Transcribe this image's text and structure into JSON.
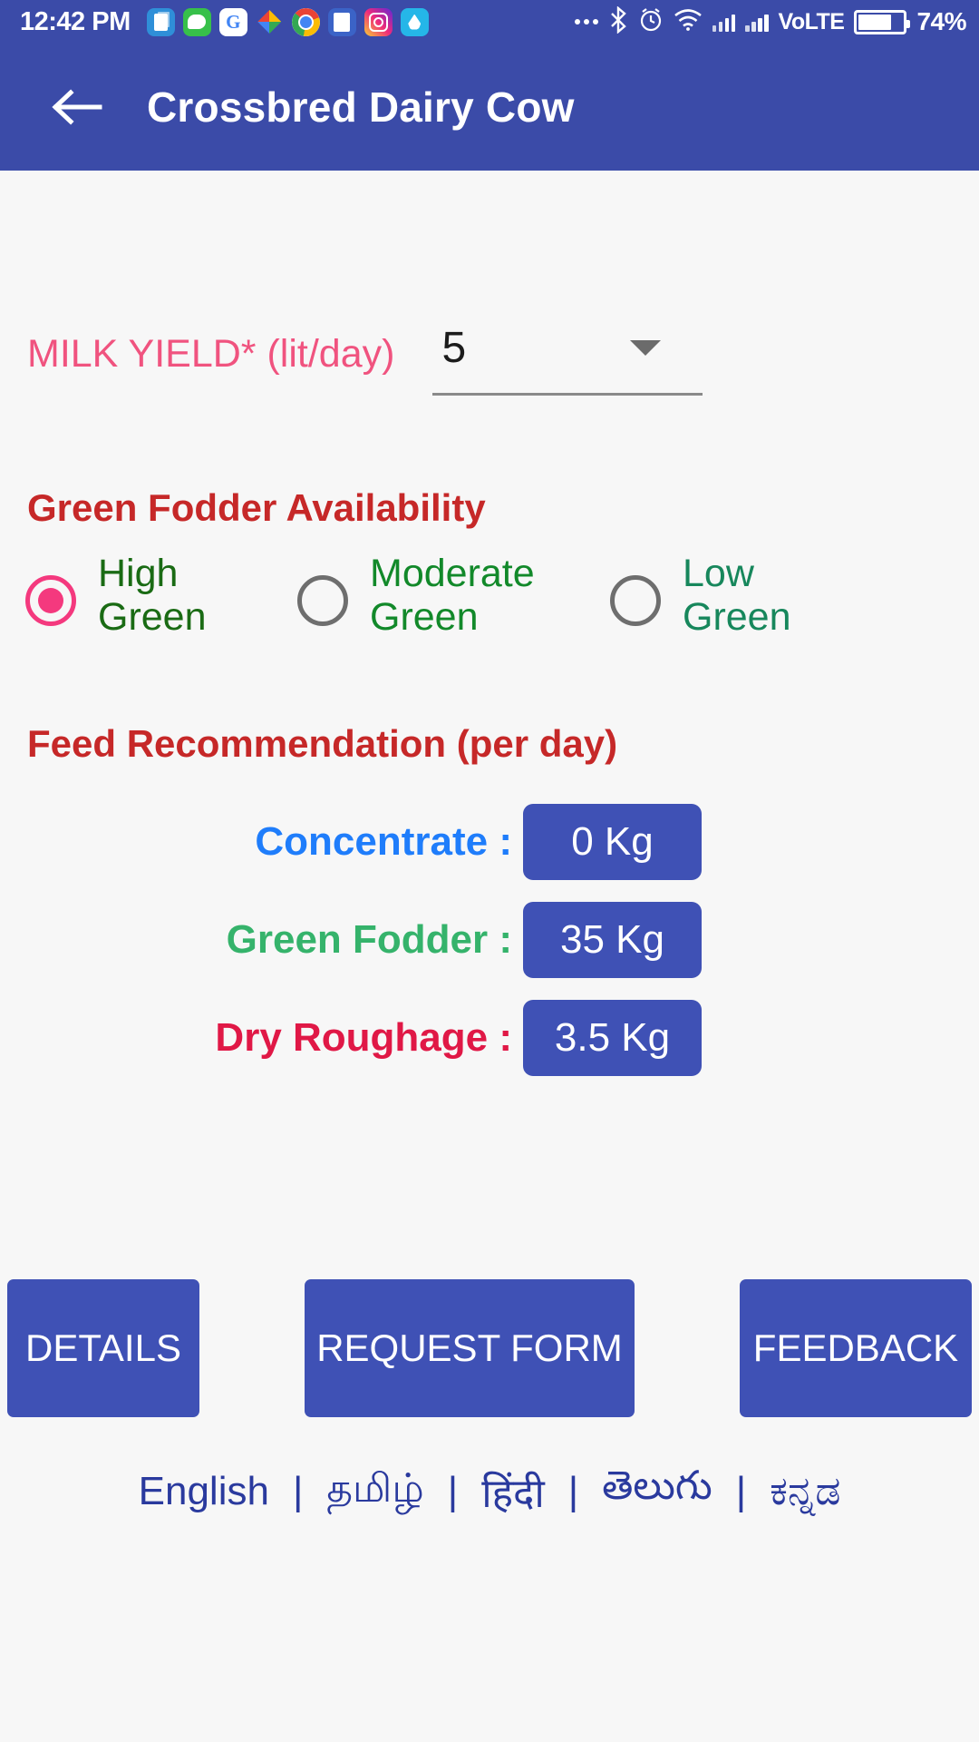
{
  "statusbar": {
    "clock": "12:42 PM",
    "app_icons": [
      "files-icon",
      "messages-icon",
      "google-icon",
      "photos-icon",
      "chrome-icon",
      "news-icon",
      "instagram-icon",
      "water-drop-icon"
    ],
    "overflow": "more-icon",
    "bluetooth": "Ƀ",
    "alarm": "⏱",
    "wifi": "wifi-icon",
    "volte": "VoLTE",
    "battery_percent": "74%"
  },
  "appbar": {
    "back": "back-arrow-icon",
    "title": "Crossbred Dairy Cow",
    "bg": "#3b4ba8"
  },
  "form": {
    "milk_yield_label": "MILK YIELD* (lit/day)",
    "milk_yield_value": "5",
    "milk_yield_options": [
      "5"
    ],
    "milk_yield_color": "#f0537f"
  },
  "fodder": {
    "heading": "Green Fodder Availability",
    "heading_color": "#c62828",
    "options": [
      {
        "label": "High\nGreen",
        "line1": "High",
        "line2": "Green",
        "selected": true
      },
      {
        "label": "Moderate\nGreen",
        "line1": "Moderate",
        "line2": "Green",
        "selected": false
      },
      {
        "label": "Low\nGreen",
        "line1": "Low",
        "line2": "Green",
        "selected": false
      }
    ],
    "selected_color": "#f4397e"
  },
  "feed": {
    "heading": "Feed Recommendation (per day)",
    "heading_color": "#c62828",
    "badge_color": "#3f51b5",
    "rows": [
      {
        "name": "Concentrate :",
        "value": "0 Kg",
        "color": "#1f7dfb"
      },
      {
        "name": "Green Fodder :",
        "value": "35 Kg",
        "color": "#35b36b"
      },
      {
        "name": "Dry Roughage :",
        "value": "3.5 Kg",
        "color": "#e01846"
      }
    ]
  },
  "buttons": {
    "details": "DETAILS",
    "request_form": "REQUEST FORM",
    "feedback": "FEEDBACK"
  },
  "languages": {
    "separator": "|",
    "items": [
      "English",
      "தமிழ்",
      "हिंदी",
      "తెలుగు",
      "ಕನ್ನಡ"
    ],
    "color": "#2a3a9e"
  }
}
